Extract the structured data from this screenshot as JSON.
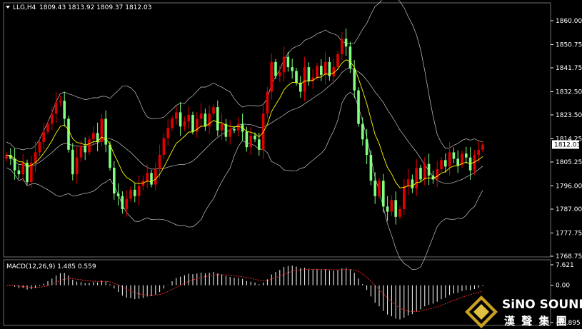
{
  "header": {
    "symbol": "LLG,H4",
    "ohlc": "1809.43 1813.92 1809.37 1812.03"
  },
  "price_axis": {
    "ticks": [
      "1860.00",
      "1850.75",
      "1841.75",
      "1832.50",
      "1823.50",
      "1814.25",
      "1805.25",
      "1796.00",
      "1787.00",
      "1777.75",
      "1768.75"
    ],
    "current_label": "1812.03"
  },
  "macd_panel": {
    "label": "MACD(12,26,9) 1.485 0.559",
    "ticks": [
      "7.621",
      "0.00",
      "-13.895"
    ]
  },
  "brand": {
    "name": "SiNO SOUND",
    "chinese": "漢 聲 集 團"
  },
  "colors": {
    "bull_candle": "#e00000",
    "bear_candle": "#80ff80",
    "bollinger": "#c8c8c8",
    "moving_average": "#ffff00",
    "macd_histogram": "#ffffff",
    "macd_signal": "#ff3030",
    "background": "#000000"
  },
  "chart_data": {
    "type": "candlestick",
    "timeframe": "H4",
    "price_range": [
      1768.75,
      1864.0
    ],
    "last_price": 1812.03,
    "close": [
      1808.0,
      1806.5,
      1802.0,
      1800.5,
      1805.0,
      1797.5,
      1805.0,
      1809.0,
      1813.0,
      1817.0,
      1820.0,
      1824.0,
      1828.5,
      1829.0,
      1822.0,
      1810.0,
      1800.5,
      1807.0,
      1811.5,
      1809.0,
      1814.0,
      1816.5,
      1813.0,
      1822.0,
      1812.0,
      1803.0,
      1793.0,
      1792.0,
      1787.0,
      1791.0,
      1794.5,
      1792.0,
      1796.0,
      1798.0,
      1801.0,
      1796.5,
      1802.5,
      1808.0,
      1814.5,
      1818.5,
      1822.0,
      1824.5,
      1819.0,
      1821.0,
      1823.5,
      1817.0,
      1822.0,
      1824.0,
      1819.0,
      1824.0,
      1826.5,
      1817.5,
      1820.0,
      1815.0,
      1818.0,
      1817.5,
      1820.0,
      1817.0,
      1811.0,
      1815.5,
      1814.0,
      1810.0,
      1824.0,
      1832.5,
      1844.0,
      1838.5,
      1840.0,
      1846.0,
      1842.0,
      1840.5,
      1836.0,
      1832.5,
      1842.0,
      1836.5,
      1838.0,
      1842.5,
      1839.0,
      1844.0,
      1838.5,
      1842.0,
      1847.0,
      1853.0,
      1850.0,
      1841.5,
      1833.0,
      1820.0,
      1814.0,
      1808.0,
      1798.0,
      1792.0,
      1798.0,
      1788.0,
      1786.0,
      1790.5,
      1784.0,
      1787.0,
      1796.0,
      1798.5,
      1795.0,
      1803.0,
      1798.5,
      1804.5,
      1800.0,
      1798.5,
      1802.5,
      1806.0,
      1803.5,
      1809.0,
      1806.5,
      1804.0,
      1808.5,
      1807.0,
      1802.0,
      1808.0,
      1810.0,
      1812.03
    ],
    "ma_period": 20,
    "bollinger": {
      "period": 20,
      "deviation": 2
    },
    "macd": {
      "fast": 12,
      "slow": 26,
      "signal": 9,
      "value": 1.485,
      "signal_value": 0.559,
      "range": [
        -13.895,
        7.621
      ]
    }
  }
}
